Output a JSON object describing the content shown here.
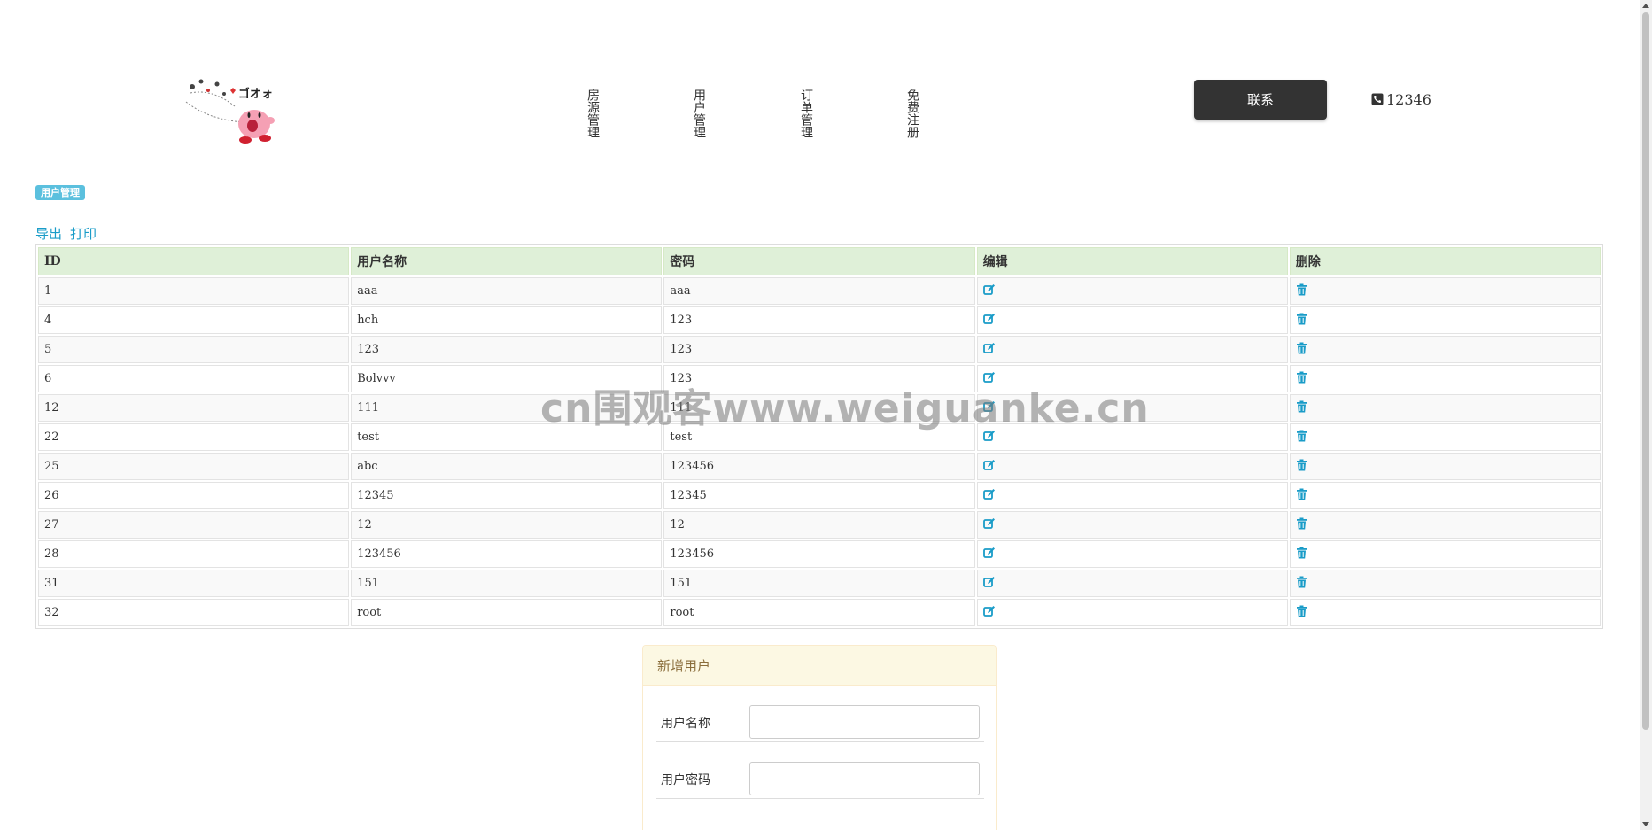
{
  "header": {
    "logo_icon": "kirby-logo-icon",
    "nav": [
      {
        "label": "房源管理"
      },
      {
        "label": "用户管理"
      },
      {
        "label": "订单管理"
      },
      {
        "label": "免费注册"
      }
    ],
    "contact_label": "联系",
    "phone": "12346"
  },
  "section": {
    "label": "用户管理",
    "export_label": "导出",
    "print_label": "打印"
  },
  "table": {
    "headers": [
      "ID",
      "用户名称",
      "密码",
      "编辑",
      "删除"
    ],
    "rows": [
      {
        "id": "1",
        "name": "aaa",
        "password": "aaa"
      },
      {
        "id": "4",
        "name": "hch",
        "password": "123"
      },
      {
        "id": "5",
        "name": "123",
        "password": "123"
      },
      {
        "id": "6",
        "name": "Bolvvv",
        "password": "123"
      },
      {
        "id": "12",
        "name": "111",
        "password": "111"
      },
      {
        "id": "22",
        "name": "test",
        "password": "test"
      },
      {
        "id": "25",
        "name": "abc",
        "password": "123456"
      },
      {
        "id": "26",
        "name": "12345",
        "password": "12345"
      },
      {
        "id": "27",
        "name": "12",
        "password": "12"
      },
      {
        "id": "28",
        "name": "123456",
        "password": "123456"
      },
      {
        "id": "31",
        "name": "151",
        "password": "151"
      },
      {
        "id": "32",
        "name": "root",
        "password": "root"
      }
    ],
    "edit_icon": "edit-icon",
    "delete_icon": "trash-icon"
  },
  "watermark": "cn围观客www.weiguanke.cn",
  "form": {
    "title": "新增用户",
    "username_label": "用户名称",
    "username_value": "",
    "password_label": "用户密码",
    "password_value": ""
  },
  "colors": {
    "accent": "#1a9cc8",
    "header_row": "#dff0d8",
    "badge": "#5bc0de",
    "contact_button": "#333333",
    "panel_head": "#fcf8e3"
  }
}
